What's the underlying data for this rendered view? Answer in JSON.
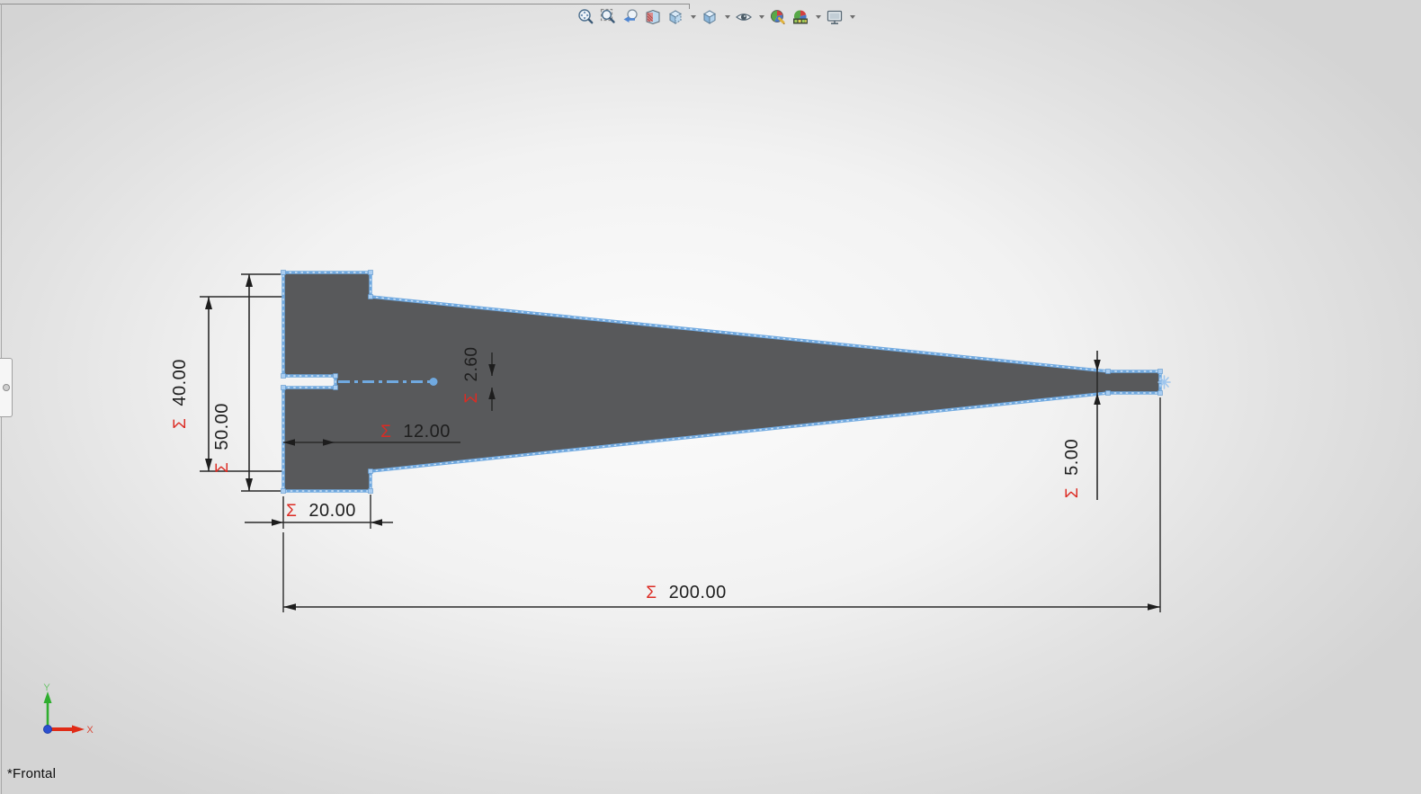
{
  "view_label": "*Frontal",
  "toolbar": {
    "items": [
      {
        "name": "zoom-to-fit"
      },
      {
        "name": "zoom-to-area"
      },
      {
        "name": "previous-view"
      },
      {
        "name": "section-view"
      },
      {
        "name": "view-orientation",
        "has_dropdown": true
      },
      {
        "name": "display-style",
        "has_dropdown": true
      },
      {
        "name": "hide-show-items",
        "has_dropdown": true
      },
      {
        "name": "edit-appearance"
      },
      {
        "name": "apply-scene",
        "has_dropdown": true
      },
      {
        "name": "view-settings",
        "has_dropdown": true
      }
    ]
  },
  "dimensions": {
    "taper_root_height": {
      "sigma": "Σ",
      "value": "40.00"
    },
    "flange_height": {
      "sigma": "Σ",
      "value": "50.00"
    },
    "flange_width": {
      "sigma": "Σ",
      "value": "20.00"
    },
    "slot_length": {
      "sigma": "Σ",
      "value": "12.00"
    },
    "slot_height": {
      "sigma": "Σ",
      "value": "2.60"
    },
    "tip_height": {
      "sigma": "Σ",
      "value": "5.00"
    },
    "total_length": {
      "sigma": "Σ",
      "value": "200.00"
    }
  },
  "triad": {
    "x_label": "X",
    "y_label": "Y"
  },
  "colors": {
    "part_fill": "#58595b",
    "edge_blue": "#70a9e0",
    "edge_blue_light": "#cfe4f8",
    "vertex_blue": "#a9cdf1",
    "sigma_red": "#dc2b23",
    "dim_color": "#2a2a2a",
    "axis_green": "#2fae2f",
    "axis_red": "#e02b16",
    "origin_blue": "#2b4fd0",
    "bg_center": "#fcfcfc",
    "bg_edge": "#d4d4d4"
  }
}
